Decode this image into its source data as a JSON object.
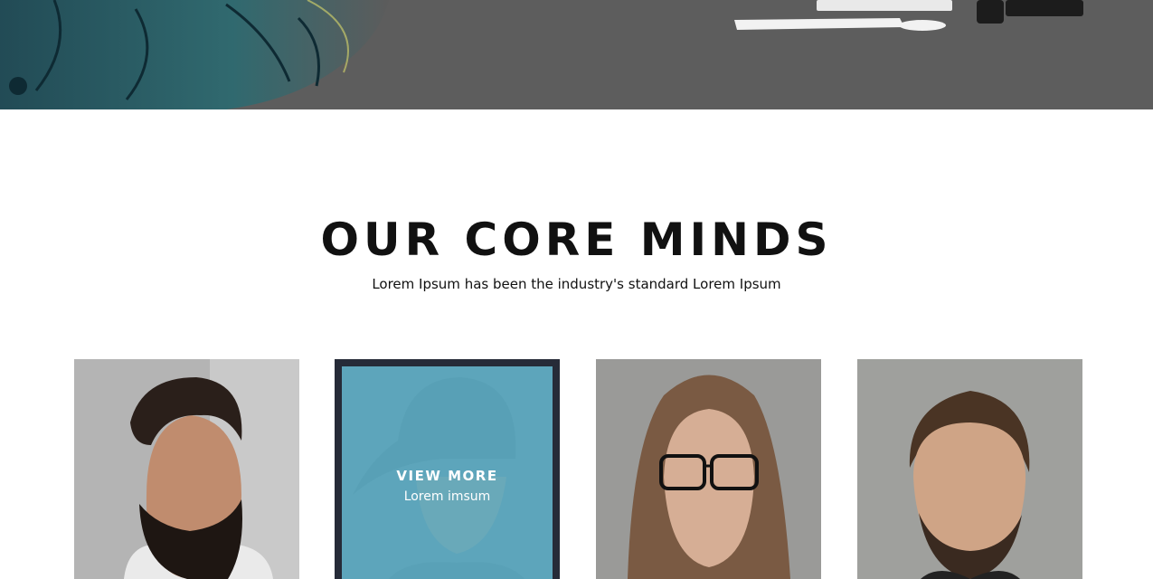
{
  "section": {
    "title": "OUR CORE MINDS",
    "subtitle": "Lorem Ipsum has been the industry's standard Lorem Ipsum"
  },
  "team": [
    {
      "photo": "bearded-man-photo"
    },
    {
      "photo": "man-in-cap-photo",
      "overlay_label": "VIEW MORE",
      "overlay_sub": "Lorem imsum"
    },
    {
      "photo": "woman-with-glasses-photo"
    },
    {
      "photo": "man-with-short-beard-photo"
    }
  ],
  "colors": {
    "hero_background": "#5c5c5c",
    "overlay": "#5aafc8",
    "card_frame": "#262b38"
  }
}
